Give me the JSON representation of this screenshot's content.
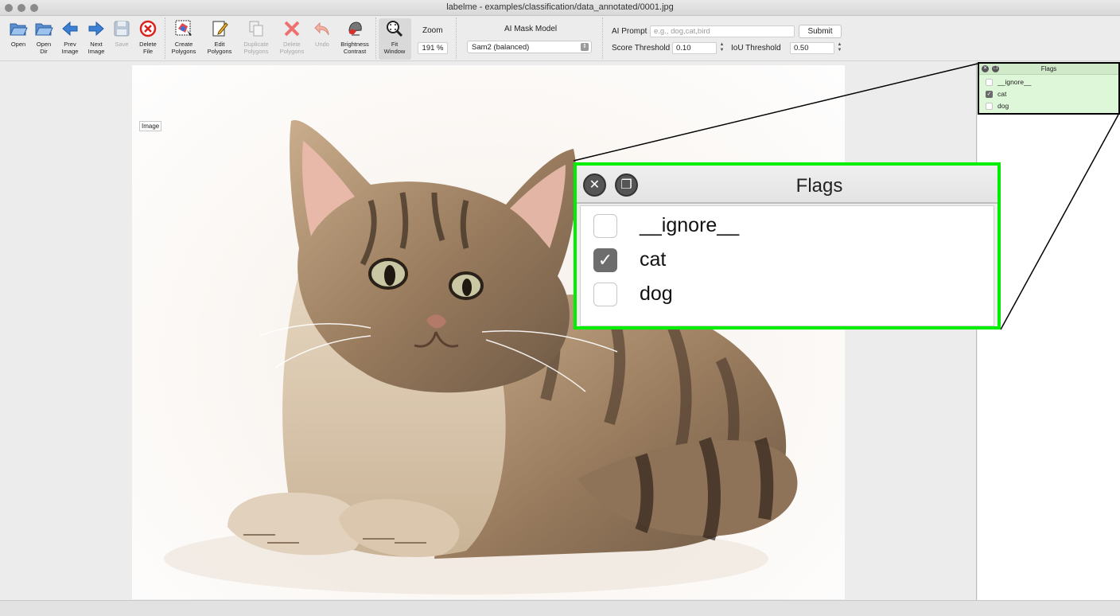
{
  "window": {
    "title": "labelme - examples/classification/data_annotated/0001.jpg"
  },
  "toolbar": {
    "open": "Open",
    "open_dir": [
      "Open",
      "Dir"
    ],
    "prev_image": [
      "Prev",
      "Image"
    ],
    "next_image": [
      "Next",
      "Image"
    ],
    "save": "Save",
    "delete_file": [
      "Delete",
      "File"
    ],
    "create_polygons": [
      "Create",
      "Polygons"
    ],
    "edit_polygons": [
      "Edit",
      "Polygons"
    ],
    "duplicate_polygons": [
      "Duplicate",
      "Polygons"
    ],
    "delete_polygons": [
      "Delete",
      "Polygons"
    ],
    "undo": "Undo",
    "brightness_contrast": [
      "Brightness",
      "Contrast"
    ],
    "fit_window": [
      "Fit",
      "Window"
    ],
    "zoom_label": "Zoom",
    "zoom_value": "191 %",
    "ai_mask_model_label": "AI Mask Model",
    "ai_mask_model_value": "Sam2 (balanced)",
    "ai_prompt_label": "AI Prompt",
    "ai_prompt_placeholder": "e.g., dog,cat,bird",
    "submit": "Submit",
    "score_threshold_label": "Score Threshold",
    "score_threshold_value": "0.10",
    "iou_threshold_label": "IoU Threshold",
    "iou_threshold_value": "0.50"
  },
  "canvas": {
    "image_tag": "Image"
  },
  "flags_panel": {
    "title": "Flags",
    "items": [
      {
        "label": "__ignore__",
        "checked": false
      },
      {
        "label": "cat",
        "checked": true
      },
      {
        "label": "dog",
        "checked": false
      }
    ]
  },
  "icons": [
    "folder-open-icon",
    "folder-dir-icon",
    "arrow-left-icon",
    "arrow-right-icon",
    "floppy-save-icon",
    "delete-circle-icon",
    "create-polygon-icon",
    "edit-pencil-icon",
    "duplicate-icon",
    "delete-x-icon",
    "undo-icon",
    "brightness-icon",
    "magnifier-fit-icon"
  ],
  "colors": {
    "highlight": "#00ee00",
    "flags_dock_bg": "#dff7d9"
  }
}
